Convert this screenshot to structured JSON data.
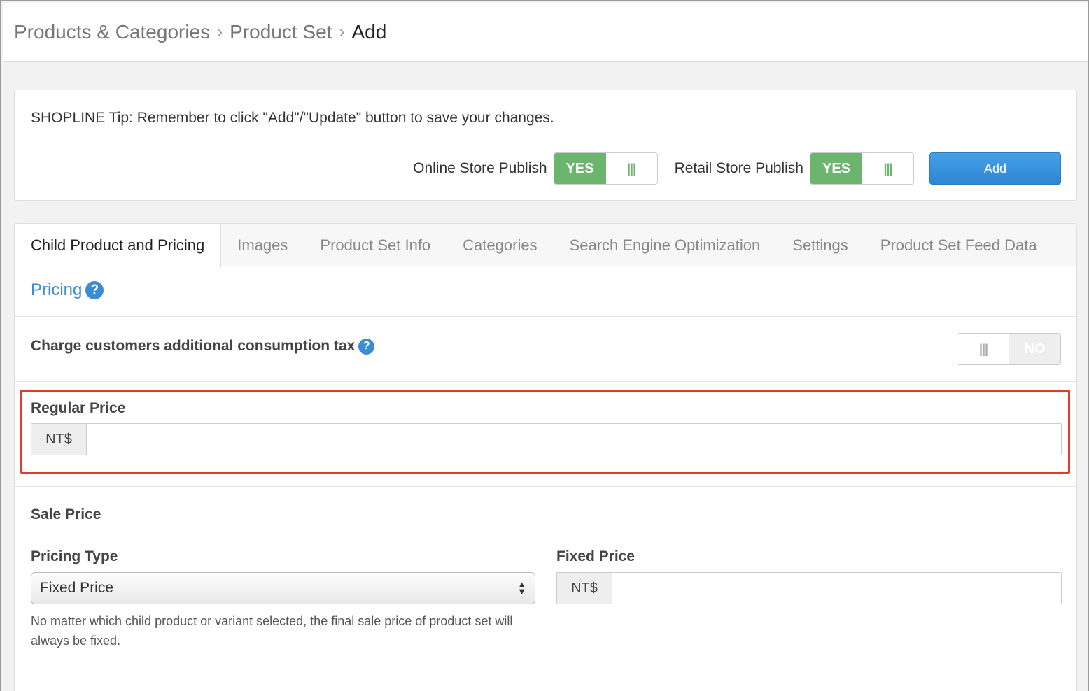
{
  "breadcrumb": {
    "items": [
      "Products & Categories",
      "Product Set"
    ],
    "current": "Add",
    "separator": ">"
  },
  "tip": {
    "text": "SHOPLINE Tip: Remember to click \"Add\"/\"Update\" button to save your changes."
  },
  "publish": {
    "online_label": "Online Store Publish",
    "online_value": "YES",
    "retail_label": "Retail Store Publish",
    "retail_value": "YES",
    "grip": "|||"
  },
  "add_button": {
    "label": "Add"
  },
  "tabs": [
    {
      "label": "Child Product and Pricing",
      "active": true
    },
    {
      "label": "Images"
    },
    {
      "label": "Product Set Info"
    },
    {
      "label": "Categories"
    },
    {
      "label": "Search Engine Optimization"
    },
    {
      "label": "Settings"
    },
    {
      "label": "Product Set Feed Data"
    }
  ],
  "pricing": {
    "title": "Pricing",
    "help": "?",
    "tax_label": "Charge customers additional consumption tax",
    "tax_value": "NO",
    "tax_grip": "|||",
    "regular_label": "Regular Price",
    "currency": "NT$",
    "regular_value": ""
  },
  "sale": {
    "title": "Sale Price",
    "pricing_type_label": "Pricing Type",
    "pricing_type_value": "Fixed Price",
    "fixed_label": "Fixed Price",
    "currency": "NT$",
    "fixed_value": "",
    "help_text": "No matter which child product or variant selected, the final sale price of product set will always be fixed."
  },
  "colors": {
    "toggle_on": "#6cb56f",
    "primary": "#2f86d4",
    "link": "#3a8bd8",
    "highlight": "#e23b2b"
  }
}
